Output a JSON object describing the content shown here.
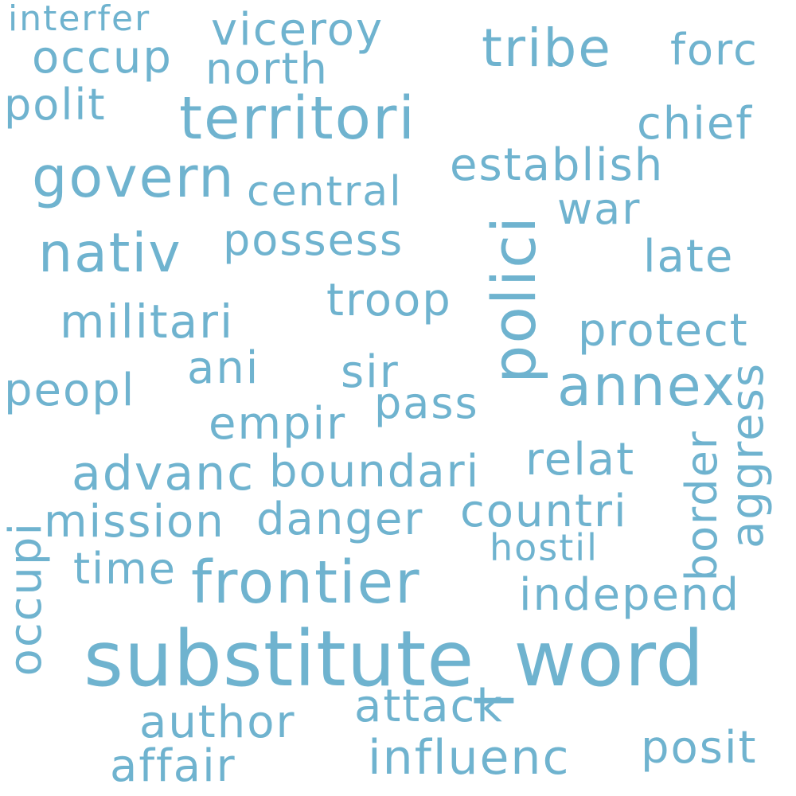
{
  "word_color": "#6fb3cf",
  "background": "#ffffff",
  "words": {
    "interfer": "interfer",
    "viceroy": "viceroy",
    "occup": "occup",
    "north": "north",
    "tribe": "tribe",
    "forc": "forc",
    "polit": "polit",
    "territori": "territori",
    "chief": "chief",
    "govern": "govern",
    "establish": "establish",
    "central": "central",
    "war": "war",
    "nativ": "nativ",
    "possess": "possess",
    "polici": "polici",
    "late": "late",
    "troop": "troop",
    "militari": "militari",
    "protect": "protect",
    "ani": "ani",
    "sir": "sir",
    "peopl": "peopl",
    "annex": "annex",
    "aggress": "aggress",
    "pass": "pass",
    "empir": "empir",
    "advanc": "advanc",
    "boundari": "boundari",
    "relat": "relat",
    "border": "border",
    "mission": "mission",
    "danger": "danger",
    "countri": "countri",
    "occupi": "occupi",
    "hostil": "hostil",
    "time": "time",
    "frontier": "frontier",
    "independ": "independ",
    "substitute_word": "substitute_word",
    "attack": "attack",
    "author": "author",
    "posit": "posit",
    "influenc": "influenc",
    "affair": "affair"
  }
}
